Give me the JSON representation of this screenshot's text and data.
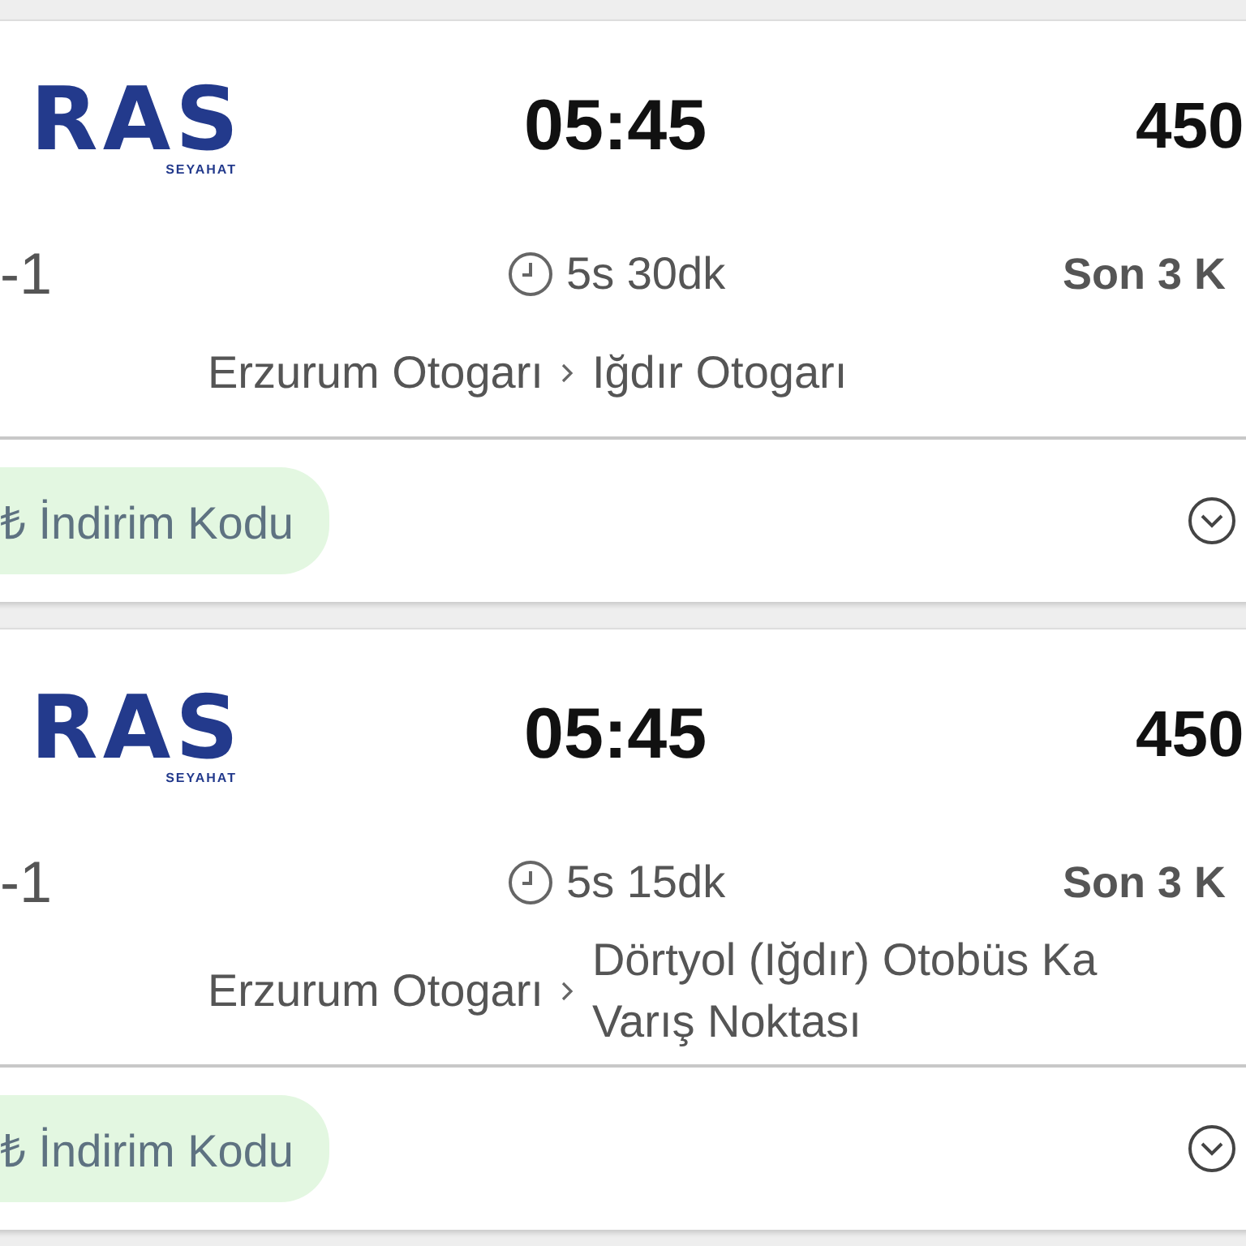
{
  "trips": [
    {
      "logo": {
        "mark": "RAS",
        "tagline": "SEYAHAT"
      },
      "departure": "05:45",
      "price": "450",
      "seat_info": "-1",
      "duration": "5s 30dk",
      "availability": "Son 3 K",
      "route": {
        "origin": "Erzurum Otogarı",
        "destination_lines": [
          "Iğdır Otogarı"
        ]
      },
      "discount": "₺ İndirim Kodu",
      "expanded": false
    },
    {
      "logo": {
        "mark": "RAS",
        "tagline": "SEYAHAT"
      },
      "departure": "05:45",
      "price": "450",
      "seat_info": "-1",
      "duration": "5s 15dk",
      "availability": "Son 3 K",
      "route": {
        "origin": "Erzurum Otogarı",
        "destination_lines": [
          "Dörtyol (Iğdır) Otobüs Ka",
          "Varış Noktası"
        ]
      },
      "discount": "₺ İndirim Kodu",
      "expanded": false
    }
  ]
}
